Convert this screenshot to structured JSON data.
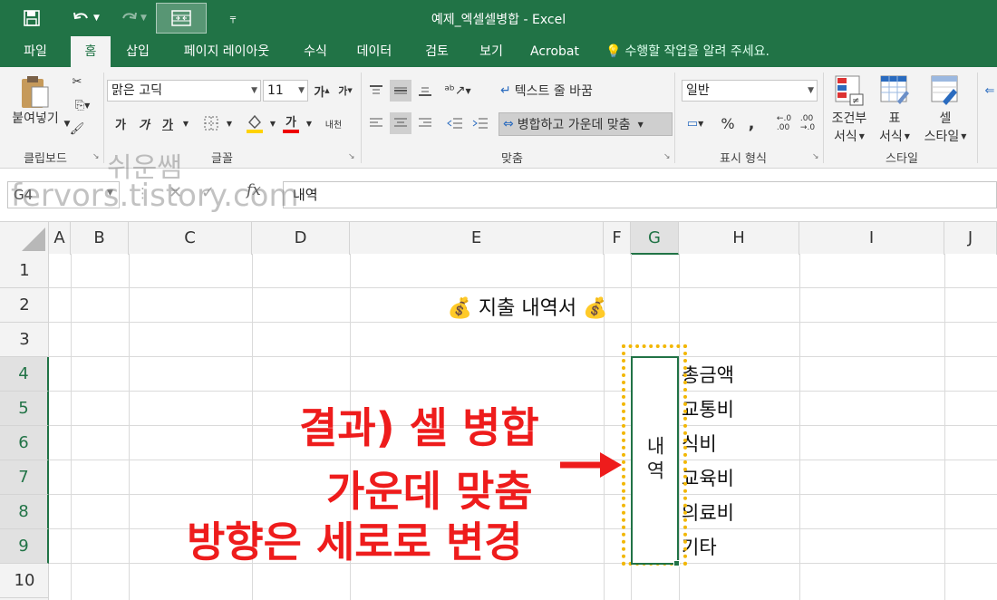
{
  "titlebar": {
    "title": "예제_엑셀셀병합 - Excel",
    "save_icon": "save-icon",
    "undo_icon": "undo-icon",
    "redo_icon": "redo-icon",
    "merge_icon": "merge-center-icon",
    "customize_icon": "customize-qat-icon",
    "color": "#217346"
  },
  "tabs": {
    "items": [
      "파일",
      "홈",
      "삽입",
      "페이지 레이아웃",
      "수식",
      "데이터",
      "검토",
      "보기",
      "Acrobat"
    ],
    "active": "홈",
    "tell_me": "수행할 작업을 알려 주세요."
  },
  "ribbon": {
    "clipboard": {
      "label": "클립보드",
      "paste": "붙여넣기"
    },
    "font": {
      "label": "글꼴",
      "font_name": "맑은 고딕",
      "font_size": "11",
      "grow": "가",
      "shrink": "가",
      "bold": "가",
      "italic": "가",
      "underline": "가",
      "font_color_glyph": "가",
      "phonetic": "내천"
    },
    "alignment": {
      "label": "맞춤",
      "wrap_text": "텍스트 줄 바꿈",
      "merge_center": "병합하고 가운데 맞춤"
    },
    "number": {
      "label": "표시 형식",
      "format": "일반",
      "percent": "%",
      "comma": ","
    },
    "styles": {
      "label": "스타일",
      "conditional_line1": "조건부",
      "conditional_line2": "서식",
      "table_line1": "표",
      "table_line2": "서식",
      "cell_line1": "셀",
      "cell_line2": "스타일"
    }
  },
  "formula_bar": {
    "name_box": "G4",
    "fx": "fx",
    "value": "내역"
  },
  "sheet": {
    "columns": [
      "A",
      "B",
      "C",
      "D",
      "E",
      "F",
      "G",
      "H",
      "I",
      "J"
    ],
    "selected_column": "G",
    "rows": [
      "1",
      "2",
      "3",
      "4",
      "5",
      "6",
      "7",
      "8",
      "9",
      "10"
    ],
    "selected_rows": [
      "4",
      "5",
      "6",
      "7",
      "8",
      "9"
    ],
    "title": "💰 지출 내역서 💰",
    "merged_cell": "내역",
    "h_items": [
      "총금액",
      "교통비",
      "식비",
      "교육비",
      "의료비",
      "기타"
    ]
  },
  "annotation": {
    "line1": "결과) 셀 병합",
    "line2": "가운데 맞춤",
    "line3": "방향은 세로로 변경",
    "color": "#ee1c1c"
  },
  "watermarks": {
    "name": "쉬운쌤",
    "url": "fervors.tistory.com"
  }
}
